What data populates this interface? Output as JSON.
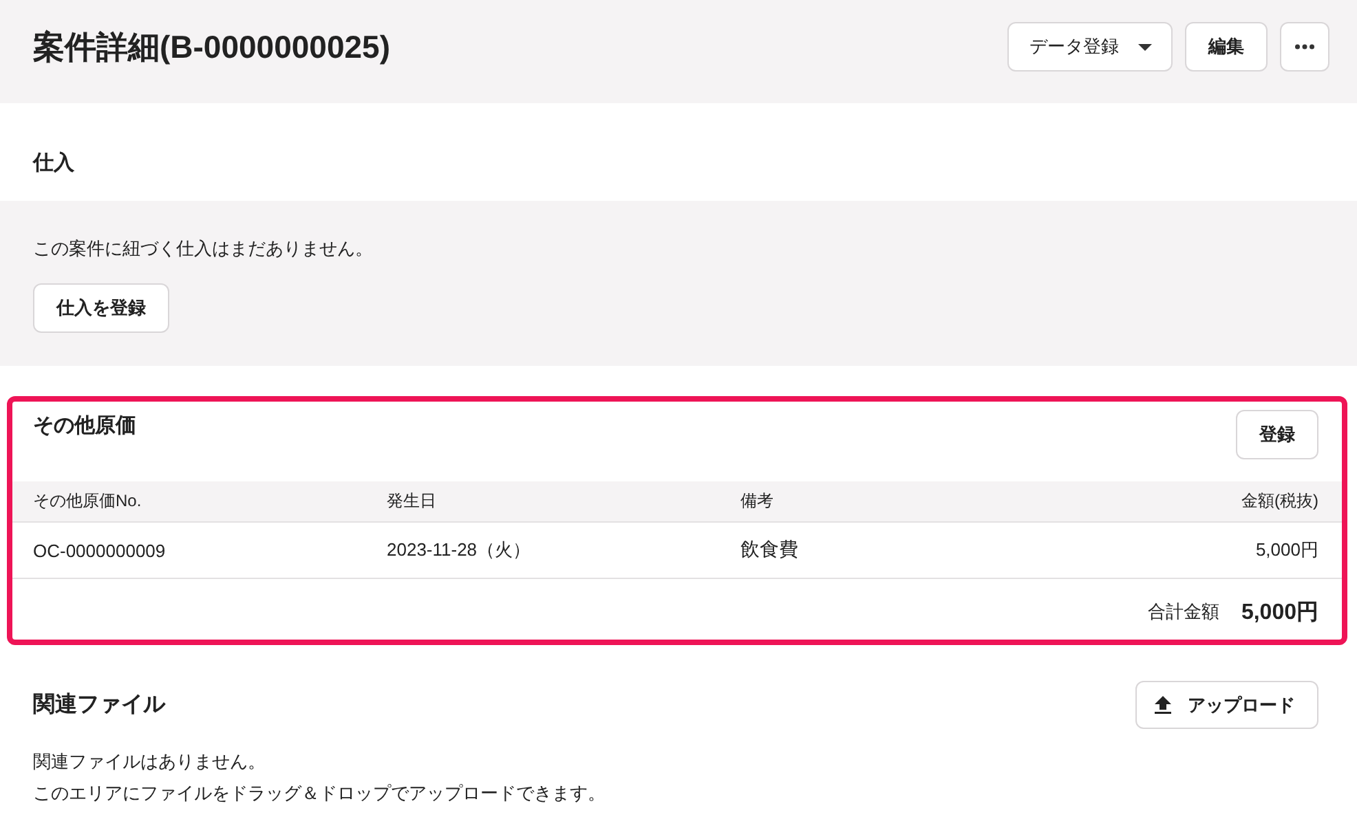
{
  "header": {
    "title": "案件詳細(B-0000000025)",
    "buttons": [
      {
        "kind": "dropdown",
        "label": "データ登録"
      },
      {
        "kind": "plain",
        "label": "編集"
      },
      {
        "kind": "more"
      }
    ]
  },
  "purchases": {
    "title": "仕入",
    "empty_message": "この案件に紐づく仕入はまだありません。",
    "button": "仕入を登録"
  },
  "other_costs": {
    "highlighted": true,
    "title": "その他原価",
    "button": "登録",
    "columns": [
      "その他原価No.",
      "発生日",
      "備考",
      "金額(税抜)"
    ],
    "rows": [
      [
        "OC-0000000009",
        "2023-11-28（火）",
        "飲食費",
        "5,000円"
      ]
    ],
    "total_label": "合計金額",
    "total_value": "5,000円"
  },
  "files": {
    "title": "関連ファイル",
    "button": "アップロード",
    "empty_lines": [
      "関連ファイルはありません。",
      "このエリアにファイルをドラッグ＆ドロップでアップロードできます。"
    ]
  }
}
